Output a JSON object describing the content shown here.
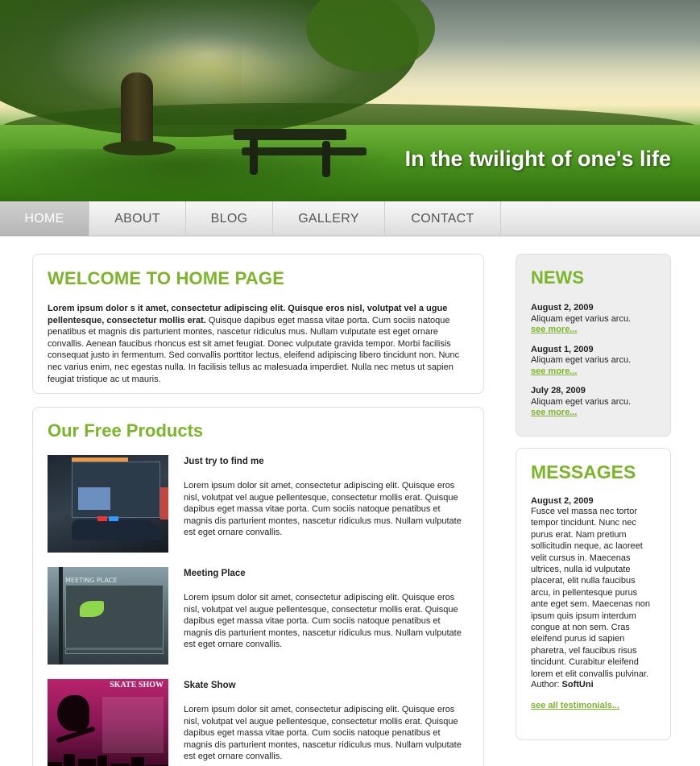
{
  "header": {
    "tagline": "In the twilight of one's life"
  },
  "nav": {
    "items": [
      {
        "label": "HOME",
        "active": true
      },
      {
        "label": "ABOUT",
        "active": false
      },
      {
        "label": "BLOG",
        "active": false
      },
      {
        "label": "GALLERY",
        "active": false
      },
      {
        "label": "CONTACT",
        "active": false
      }
    ]
  },
  "welcome": {
    "title": "WELCOME TO HOME PAGE",
    "bold_text": "Lorem ipsum dolor s it amet, consectetur adipiscing elit. Quisque eros nisl, volutpat vel a ugue pellentesque, consectetur mollis erat.",
    "text": " Quisque dapibus eget massa vitae porta. Cum sociis natoque penatibus et magnis dis parturient montes, nascetur ridiculus mus. Nullam vulputate est eget ornare convallis. Aenean faucibus rhoncus est sit amet feugiat. Donec vulputate gravida tempor. Morbi facilisis consequat justo in fermentum. Sed convallis porttitor lectus, eleifend adipiscing libero tincidunt non. Nunc nec varius enim, nec egestas nulla. In facilisis tellus ac malesuada imperdiet. Nulla nec metus ut sapien feugiat tristique ac ut mauris."
  },
  "products": {
    "title": "Our Free Products",
    "items": [
      {
        "name": "Just try to find me",
        "description": "Lorem ipsum dolor sit amet, consectetur adipiscing elit. Quisque eros nisl, volutpat vel augue pellentesque, consectetur mollis erat. Quisque dapibus eget massa vitae porta. Cum sociis natoque penatibus et magnis dis parturient montes, nascetur ridiculus mus. Nullam vulputate est eget ornare convallis."
      },
      {
        "name": "Meeting Place",
        "description": "Lorem ipsum dolor sit amet, consectetur adipiscing elit. Quisque eros nisl, volutpat vel augue pellentesque, consectetur mollis erat. Quisque dapibus eget massa vitae porta. Cum sociis natoque penatibus et magnis dis parturient montes, nascetur ridiculus mus. Nullam vulputate est eget ornare convallis.",
        "thumb_label": "MEETING PLACE"
      },
      {
        "name": "Skate Show",
        "description": "Lorem ipsum dolor sit amet, consectetur adipiscing elit. Quisque eros nisl, volutpat vel augue pellentesque, consectetur mollis erat. Quisque dapibus eget massa vitae porta. Cum sociis natoque penatibus et magnis dis parturient montes, nascetur ridiculus mus. Nullam vulputate est eget ornare convallis.",
        "thumb_label": "SKATE SHOW"
      }
    ]
  },
  "news": {
    "title": "NEWS",
    "items": [
      {
        "date": "August 2, 2009",
        "text": "Aliquam eget varius arcu.",
        "link": "see more..."
      },
      {
        "date": "August 1, 2009",
        "text": "Aliquam eget varius arcu.",
        "link": "see more..."
      },
      {
        "date": "July 28, 2009",
        "text": "Aliquam eget varius arcu.",
        "link": "see more..."
      }
    ]
  },
  "messages": {
    "title": "MESSAGES",
    "date": "August 2, 2009",
    "text": "Fusce vel massa nec tortor tempor tincidunt. Nunc nec purus erat. Nam pretium sollicitudin neque, ac laoreet velit cursus in. Maecenas ultrices, nulla id vulputate placerat, elit nulla faucibus arcu, in pellentesque purus ante eget sem. Maecenas non ipsum quis ipsum interdum congue at non sem. Cras eleifend purus id sapien pharetra, vel faucibus risus tincidunt. Curabitur eleifend lorem et elit convallis pulvinar.",
    "author_label": "Author:",
    "author": "SoftUni",
    "all_link": "see all testimonials..."
  },
  "colors": {
    "accent_green": "#7ab52a",
    "nav_active_bg": "#b5b5b5"
  }
}
